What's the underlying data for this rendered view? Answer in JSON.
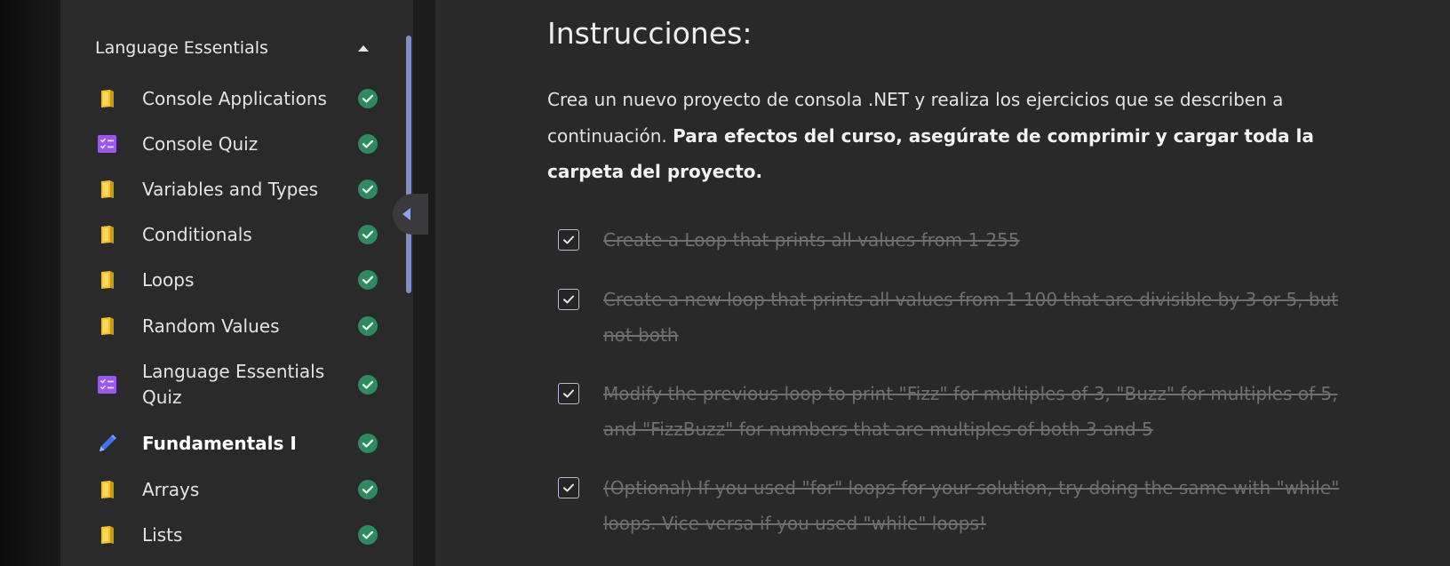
{
  "sidebar": {
    "section_title": "Language Essentials",
    "lessons": [
      {
        "label": "Console Applications",
        "icon": "book-icon",
        "completed": true
      },
      {
        "label": "Console Quiz",
        "icon": "quiz-icon",
        "completed": true
      },
      {
        "label": "Variables and Types",
        "icon": "book-icon",
        "completed": true
      },
      {
        "label": "Conditionals",
        "icon": "book-icon",
        "completed": true
      },
      {
        "label": "Loops",
        "icon": "book-icon",
        "completed": true
      },
      {
        "label": "Random Values",
        "icon": "book-icon",
        "completed": true
      },
      {
        "label": "Language Essentials Quiz",
        "icon": "quiz-icon",
        "completed": true
      },
      {
        "label": "Fundamentals I",
        "icon": "pencil-icon",
        "completed": true,
        "active": true
      },
      {
        "label": "Arrays",
        "icon": "book-icon",
        "completed": true
      },
      {
        "label": "Lists",
        "icon": "book-icon",
        "completed": true
      }
    ]
  },
  "content": {
    "heading": "Instrucciones:",
    "intro_text": "Crea un nuevo proyecto de consola .NET y realiza los ejercicios que se describen a continuación.",
    "intro_bold": "Para efectos del curso, asegúrate de comprimir y cargar toda la carpeta del proyecto.",
    "tasks": [
      {
        "text": "Create a Loop that prints all values from 1-255",
        "checked": true
      },
      {
        "text": "Create a new loop that prints all values from 1-100 that are divisible by 3 or 5, but not both",
        "checked": true
      },
      {
        "text": "Modify the previous loop to print \"Fizz\" for multiples of 3, \"Buzz\" for multiples of 5, and \"FizzBuzz\" for numbers that are multiples of both 3 and 5",
        "checked": true
      },
      {
        "text": "(Optional) If you used \"for\" loops for your solution, try doing the same with \"while\" loops. Vice-versa if you used \"while\" loops!",
        "checked": true
      }
    ]
  },
  "colors": {
    "book": "#f2c230",
    "quiz": "#9a59e8",
    "pencil": "#3f74ee",
    "check_circle": "#2f8a62",
    "scrollbar": "#7f8fc9"
  }
}
